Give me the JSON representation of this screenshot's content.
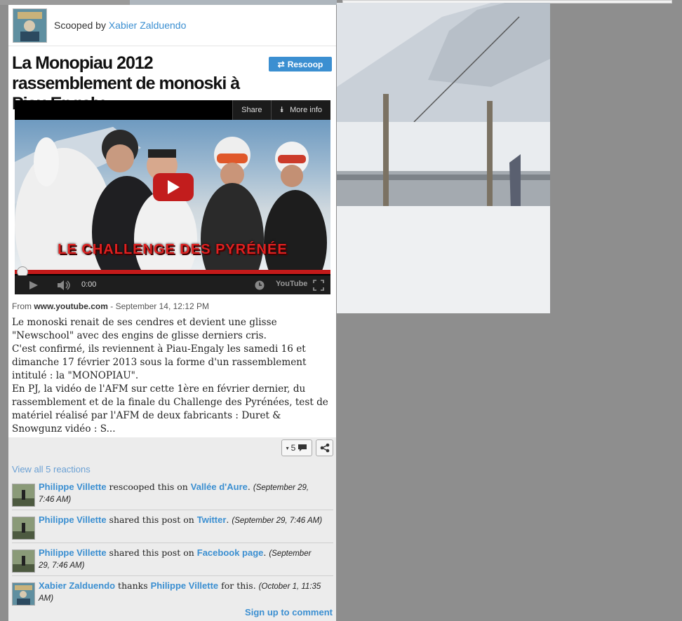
{
  "post": {
    "scooped_prefix": "Scooped by",
    "author": "Xabier Zalduendo",
    "title": "La Monopiau 2012 rassemblement de monoski à Piau Engaly",
    "rescoop_label": "Rescoop",
    "source_prefix": "From",
    "source_domain": "www.youtube.com",
    "source_date": "- September 14, 12:12 PM",
    "paragraphs": [
      "Le monoski renait de ses cendres et devient une glisse \"Newschool\" avec des engins de glisse derniers cris.",
      "C'est confirmé, ils reviennent à Piau-Engaly les samedi 16 et dimanche 17 février 2013 sous la forme d'un rassemblement intitulé : la \"MONOPIAU\".",
      "En PJ, la vidéo de l'AFM sur cette 1ère en février dernier,  du rassemblement et de la finale du Challenge des Pyrénées, test de matériel réalisé par l'AFM de deux fabricants : Duret & Snowgunz vidéo : S..."
    ]
  },
  "video": {
    "share_label": "Share",
    "more_info_label": "More info",
    "overlay_text": "LE CHALLENGE DES PYRÉNÉE",
    "time": "0:00",
    "brand": "YouTube"
  },
  "reactions": {
    "count": "5",
    "view_all": "View all 5 reactions",
    "items": [
      {
        "user": "Philippe Villette",
        "action": " rescooped this on ",
        "target": "Vallée d'Aure",
        "date": "(September 29, 7:46 AM)"
      },
      {
        "user": "Philippe Villette",
        "action": " shared this post on ",
        "target": "Twitter",
        "date": "(September 29, 7:46 AM)"
      },
      {
        "user": "Philippe Villette",
        "action": " shared this post on ",
        "target": "Facebook page",
        "date": "(September 29, 7:46 AM)"
      },
      {
        "user": "Xabier Zalduendo",
        "action": " thanks ",
        "target": "Philippe Villette",
        "suffix": " for this. ",
        "date": "(October 1, 11:35 AM)"
      }
    ],
    "signup": "Sign up to comment"
  },
  "colors": {
    "link": "#3b8fd1",
    "progress": "#c41a1a"
  }
}
